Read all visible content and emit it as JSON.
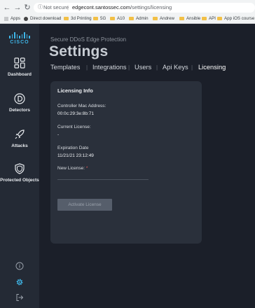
{
  "browser": {
    "security_label": "Not secure",
    "url_host": "edgecont.santossec.com",
    "url_path": "/settings/licensing",
    "bookmarks": [
      {
        "label": "Apps",
        "icon": "apps-grid-icon"
      },
      {
        "label": "Direct download",
        "icon": "globe-icon"
      },
      {
        "label": "3d Printing",
        "icon": "folder-icon"
      },
      {
        "label": "5G",
        "icon": "folder-icon"
      },
      {
        "label": "A10",
        "icon": "folder-icon"
      },
      {
        "label": "Admin",
        "icon": "folder-icon"
      },
      {
        "label": "Andrew",
        "icon": "folder-icon"
      },
      {
        "label": "Ansible",
        "icon": "folder-icon"
      },
      {
        "label": "API",
        "icon": "folder-icon"
      },
      {
        "label": "App iOS course",
        "icon": "folder-icon"
      }
    ]
  },
  "sidebar": {
    "logo_text": "CISCO",
    "items": [
      {
        "label": "Dashboard",
        "icon": "dashboard-grid-icon"
      },
      {
        "label": "Detectors",
        "icon": "detector-d-icon"
      },
      {
        "label": "Attacks",
        "icon": "rocket-icon"
      },
      {
        "label": "Protected Objects",
        "icon": "shield-icon"
      }
    ],
    "bottom_icons": [
      "info-icon",
      "settings-gear-icon",
      "logout-icon"
    ]
  },
  "header": {
    "subtitle": "Secure DDoS Edge Protection",
    "title": "Settings",
    "tabs": [
      {
        "label": "Templates",
        "active": false
      },
      {
        "label": "Integrations",
        "active": false
      },
      {
        "label": "Users",
        "active": false
      },
      {
        "label": "Api Keys",
        "active": false
      },
      {
        "label": "Licensing",
        "active": true
      }
    ]
  },
  "licensing": {
    "heading": "Licensing Info",
    "mac_label": "Controller Mac Address:",
    "mac_value": "00:0c:29:3e:8b:71",
    "current_label": "Current License:",
    "current_value": "-",
    "expiration_label": "Expiration Date",
    "expiration_value": "11/21/21 23:12:49",
    "new_license_label": "New License:",
    "required_marker": "*",
    "new_license_value": "",
    "activate_label": "Activate License"
  },
  "colors": {
    "accent": "#3fb6e8",
    "background": "#1b1f29",
    "sidebar": "#242a35",
    "card": "#2a303b"
  }
}
